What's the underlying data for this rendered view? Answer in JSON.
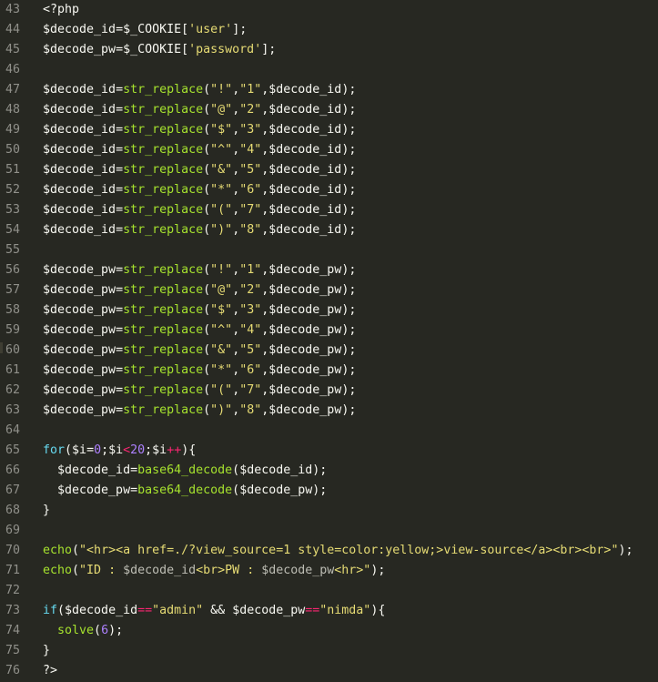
{
  "colors": {
    "background": "#272822",
    "line_number": "#90908a",
    "default": "#f8f8f2",
    "function": "#a6e22e",
    "keyword": "#66d9ef",
    "string": "#e6db74",
    "number": "#ae81ff",
    "operator": "#f92672"
  },
  "lines": [
    {
      "n": "43",
      "tokens": [
        [
          "default",
          "<?php"
        ]
      ]
    },
    {
      "n": "44",
      "tokens": [
        [
          "var",
          "$decode_id"
        ],
        [
          "default",
          "="
        ],
        [
          "var",
          "$_COOKIE"
        ],
        [
          "default",
          "["
        ],
        [
          "str",
          "'user'"
        ],
        [
          "default",
          "];"
        ]
      ]
    },
    {
      "n": "45",
      "tokens": [
        [
          "var",
          "$decode_pw"
        ],
        [
          "default",
          "="
        ],
        [
          "var",
          "$_COOKIE"
        ],
        [
          "default",
          "["
        ],
        [
          "str",
          "'password'"
        ],
        [
          "default",
          "];"
        ]
      ]
    },
    {
      "n": "46",
      "tokens": []
    },
    {
      "n": "47",
      "tokens": [
        [
          "var",
          "$decode_id"
        ],
        [
          "default",
          "="
        ],
        [
          "func",
          "str_replace"
        ],
        [
          "default",
          "("
        ],
        [
          "str",
          "\"!\""
        ],
        [
          "default",
          ","
        ],
        [
          "str",
          "\"1\""
        ],
        [
          "default",
          ","
        ],
        [
          "var",
          "$decode_id"
        ],
        [
          "default",
          ");"
        ]
      ]
    },
    {
      "n": "48",
      "tokens": [
        [
          "var",
          "$decode_id"
        ],
        [
          "default",
          "="
        ],
        [
          "func",
          "str_replace"
        ],
        [
          "default",
          "("
        ],
        [
          "str",
          "\"@\""
        ],
        [
          "default",
          ","
        ],
        [
          "str",
          "\"2\""
        ],
        [
          "default",
          ","
        ],
        [
          "var",
          "$decode_id"
        ],
        [
          "default",
          ");"
        ]
      ]
    },
    {
      "n": "49",
      "tokens": [
        [
          "var",
          "$decode_id"
        ],
        [
          "default",
          "="
        ],
        [
          "func",
          "str_replace"
        ],
        [
          "default",
          "("
        ],
        [
          "str",
          "\"$\""
        ],
        [
          "default",
          ","
        ],
        [
          "str",
          "\"3\""
        ],
        [
          "default",
          ","
        ],
        [
          "var",
          "$decode_id"
        ],
        [
          "default",
          ");"
        ]
      ]
    },
    {
      "n": "50",
      "tokens": [
        [
          "var",
          "$decode_id"
        ],
        [
          "default",
          "="
        ],
        [
          "func",
          "str_replace"
        ],
        [
          "default",
          "("
        ],
        [
          "str",
          "\"^\""
        ],
        [
          "default",
          ","
        ],
        [
          "str",
          "\"4\""
        ],
        [
          "default",
          ","
        ],
        [
          "var",
          "$decode_id"
        ],
        [
          "default",
          ");"
        ]
      ]
    },
    {
      "n": "51",
      "tokens": [
        [
          "var",
          "$decode_id"
        ],
        [
          "default",
          "="
        ],
        [
          "func",
          "str_replace"
        ],
        [
          "default",
          "("
        ],
        [
          "str",
          "\"&\""
        ],
        [
          "default",
          ","
        ],
        [
          "str",
          "\"5\""
        ],
        [
          "default",
          ","
        ],
        [
          "var",
          "$decode_id"
        ],
        [
          "default",
          ");"
        ]
      ]
    },
    {
      "n": "52",
      "tokens": [
        [
          "var",
          "$decode_id"
        ],
        [
          "default",
          "="
        ],
        [
          "func",
          "str_replace"
        ],
        [
          "default",
          "("
        ],
        [
          "str",
          "\"*\""
        ],
        [
          "default",
          ","
        ],
        [
          "str",
          "\"6\""
        ],
        [
          "default",
          ","
        ],
        [
          "var",
          "$decode_id"
        ],
        [
          "default",
          ");"
        ]
      ]
    },
    {
      "n": "53",
      "tokens": [
        [
          "var",
          "$decode_id"
        ],
        [
          "default",
          "="
        ],
        [
          "func",
          "str_replace"
        ],
        [
          "default",
          "("
        ],
        [
          "str",
          "\"(\""
        ],
        [
          "default",
          ","
        ],
        [
          "str",
          "\"7\""
        ],
        [
          "default",
          ","
        ],
        [
          "var",
          "$decode_id"
        ],
        [
          "default",
          ");"
        ]
      ]
    },
    {
      "n": "54",
      "tokens": [
        [
          "var",
          "$decode_id"
        ],
        [
          "default",
          "="
        ],
        [
          "func",
          "str_replace"
        ],
        [
          "default",
          "("
        ],
        [
          "str",
          "\")\""
        ],
        [
          "default",
          ","
        ],
        [
          "str",
          "\"8\""
        ],
        [
          "default",
          ","
        ],
        [
          "var",
          "$decode_id"
        ],
        [
          "default",
          ");"
        ]
      ]
    },
    {
      "n": "55",
      "tokens": []
    },
    {
      "n": "56",
      "tokens": [
        [
          "var",
          "$decode_pw"
        ],
        [
          "default",
          "="
        ],
        [
          "func",
          "str_replace"
        ],
        [
          "default",
          "("
        ],
        [
          "str",
          "\"!\""
        ],
        [
          "default",
          ","
        ],
        [
          "str",
          "\"1\""
        ],
        [
          "default",
          ","
        ],
        [
          "var",
          "$decode_pw"
        ],
        [
          "default",
          ");"
        ]
      ]
    },
    {
      "n": "57",
      "tokens": [
        [
          "var",
          "$decode_pw"
        ],
        [
          "default",
          "="
        ],
        [
          "func",
          "str_replace"
        ],
        [
          "default",
          "("
        ],
        [
          "str",
          "\"@\""
        ],
        [
          "default",
          ","
        ],
        [
          "str",
          "\"2\""
        ],
        [
          "default",
          ","
        ],
        [
          "var",
          "$decode_pw"
        ],
        [
          "default",
          ");"
        ]
      ]
    },
    {
      "n": "58",
      "tokens": [
        [
          "var",
          "$decode_pw"
        ],
        [
          "default",
          "="
        ],
        [
          "func",
          "str_replace"
        ],
        [
          "default",
          "("
        ],
        [
          "str",
          "\"$\""
        ],
        [
          "default",
          ","
        ],
        [
          "str",
          "\"3\""
        ],
        [
          "default",
          ","
        ],
        [
          "var",
          "$decode_pw"
        ],
        [
          "default",
          ");"
        ]
      ]
    },
    {
      "n": "59",
      "tokens": [
        [
          "var",
          "$decode_pw"
        ],
        [
          "default",
          "="
        ],
        [
          "func",
          "str_replace"
        ],
        [
          "default",
          "("
        ],
        [
          "str",
          "\"^\""
        ],
        [
          "default",
          ","
        ],
        [
          "str",
          "\"4\""
        ],
        [
          "default",
          ","
        ],
        [
          "var",
          "$decode_pw"
        ],
        [
          "default",
          ");"
        ]
      ]
    },
    {
      "n": "60",
      "tokens": [
        [
          "var",
          "$decode_pw"
        ],
        [
          "default",
          "="
        ],
        [
          "func",
          "str_replace"
        ],
        [
          "default",
          "("
        ],
        [
          "str",
          "\"&\""
        ],
        [
          "default",
          ","
        ],
        [
          "str",
          "\"5\""
        ],
        [
          "default",
          ","
        ],
        [
          "var",
          "$decode_pw"
        ],
        [
          "default",
          ");"
        ]
      ]
    },
    {
      "n": "61",
      "tokens": [
        [
          "var",
          "$decode_pw"
        ],
        [
          "default",
          "="
        ],
        [
          "func",
          "str_replace"
        ],
        [
          "default",
          "("
        ],
        [
          "str",
          "\"*\""
        ],
        [
          "default",
          ","
        ],
        [
          "str",
          "\"6\""
        ],
        [
          "default",
          ","
        ],
        [
          "var",
          "$decode_pw"
        ],
        [
          "default",
          ");"
        ]
      ]
    },
    {
      "n": "62",
      "tokens": [
        [
          "var",
          "$decode_pw"
        ],
        [
          "default",
          "="
        ],
        [
          "func",
          "str_replace"
        ],
        [
          "default",
          "("
        ],
        [
          "str",
          "\"(\""
        ],
        [
          "default",
          ","
        ],
        [
          "str",
          "\"7\""
        ],
        [
          "default",
          ","
        ],
        [
          "var",
          "$decode_pw"
        ],
        [
          "default",
          ");"
        ]
      ]
    },
    {
      "n": "63",
      "tokens": [
        [
          "var",
          "$decode_pw"
        ],
        [
          "default",
          "="
        ],
        [
          "func",
          "str_replace"
        ],
        [
          "default",
          "("
        ],
        [
          "str",
          "\")\""
        ],
        [
          "default",
          ","
        ],
        [
          "str",
          "\"8\""
        ],
        [
          "default",
          ","
        ],
        [
          "var",
          "$decode_pw"
        ],
        [
          "default",
          ");"
        ]
      ]
    },
    {
      "n": "64",
      "tokens": []
    },
    {
      "n": "65",
      "tokens": [
        [
          "kw",
          "for"
        ],
        [
          "default",
          "("
        ],
        [
          "var",
          "$i"
        ],
        [
          "default",
          "="
        ],
        [
          "num",
          "0"
        ],
        [
          "default",
          ";"
        ],
        [
          "var",
          "$i"
        ],
        [
          "op",
          "<"
        ],
        [
          "num",
          "20"
        ],
        [
          "default",
          ";"
        ],
        [
          "var",
          "$i"
        ],
        [
          "op",
          "++"
        ],
        [
          "default",
          "){"
        ]
      ]
    },
    {
      "n": "66",
      "tokens": [
        [
          "default",
          "  "
        ],
        [
          "var",
          "$decode_id"
        ],
        [
          "default",
          "="
        ],
        [
          "func",
          "base64_decode"
        ],
        [
          "default",
          "("
        ],
        [
          "var",
          "$decode_id"
        ],
        [
          "default",
          ");"
        ]
      ]
    },
    {
      "n": "67",
      "tokens": [
        [
          "default",
          "  "
        ],
        [
          "var",
          "$decode_pw"
        ],
        [
          "default",
          "="
        ],
        [
          "func",
          "base64_decode"
        ],
        [
          "default",
          "("
        ],
        [
          "var",
          "$decode_pw"
        ],
        [
          "default",
          ");"
        ]
      ]
    },
    {
      "n": "68",
      "tokens": [
        [
          "default",
          "}"
        ]
      ]
    },
    {
      "n": "69",
      "tokens": []
    },
    {
      "n": "70",
      "tokens": [
        [
          "func",
          "echo"
        ],
        [
          "default",
          "("
        ],
        [
          "str",
          "\"<hr><a href=./?view_source=1 style=color:yellow;>view-source</a><br><br>\""
        ],
        [
          "default",
          ");"
        ]
      ]
    },
    {
      "n": "71",
      "tokens": [
        [
          "func",
          "echo"
        ],
        [
          "default",
          "("
        ],
        [
          "str",
          "\"ID : "
        ],
        [
          "dim",
          "$decode_id"
        ],
        [
          "str",
          "<br>PW : "
        ],
        [
          "dim",
          "$decode_pw"
        ],
        [
          "str",
          "<hr>\""
        ],
        [
          "default",
          ");"
        ]
      ]
    },
    {
      "n": "72",
      "tokens": []
    },
    {
      "n": "73",
      "tokens": [
        [
          "kw",
          "if"
        ],
        [
          "default",
          "("
        ],
        [
          "var",
          "$decode_id"
        ],
        [
          "op",
          "=="
        ],
        [
          "str",
          "\"admin\""
        ],
        [
          "default",
          " && "
        ],
        [
          "var",
          "$decode_pw"
        ],
        [
          "op",
          "=="
        ],
        [
          "str",
          "\"nimda\""
        ],
        [
          "default",
          "){"
        ]
      ]
    },
    {
      "n": "74",
      "tokens": [
        [
          "default",
          "  "
        ],
        [
          "func",
          "solve"
        ],
        [
          "default",
          "("
        ],
        [
          "num",
          "6"
        ],
        [
          "default",
          ");"
        ]
      ]
    },
    {
      "n": "75",
      "tokens": [
        [
          "default",
          "}"
        ]
      ]
    },
    {
      "n": "76",
      "tokens": [
        [
          "default",
          "?>"
        ]
      ]
    }
  ]
}
